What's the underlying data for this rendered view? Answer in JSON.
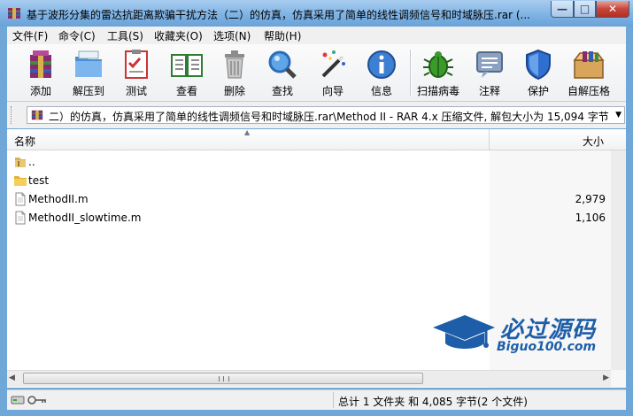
{
  "window": {
    "title": "基于波形分集的雷达抗距离欺骗干扰方法（二）的仿真，仿真采用了简单的线性调频信号和时域脉压.rar (...",
    "buttons": {
      "minimize": "—",
      "maximize": "□",
      "close": "✕"
    }
  },
  "menu": [
    "文件(F)",
    "命令(C)",
    "工具(S)",
    "收藏夹(O)",
    "选项(N)",
    "帮助(H)"
  ],
  "toolbar": [
    {
      "label": "添加",
      "icon": "add-archive-icon"
    },
    {
      "label": "解压到",
      "icon": "extract-to-icon"
    },
    {
      "label": "测试",
      "icon": "test-icon"
    },
    {
      "label": "查看",
      "icon": "view-book-icon"
    },
    {
      "label": "删除",
      "icon": "trash-icon"
    },
    {
      "label": "查找",
      "icon": "magnifier-icon"
    },
    {
      "label": "向导",
      "icon": "wizard-wand-icon"
    },
    {
      "label": "信息",
      "icon": "info-icon"
    },
    {
      "label": "扫描病毒",
      "icon": "virus-scan-icon"
    },
    {
      "label": "注释",
      "icon": "comment-icon"
    },
    {
      "label": "保护",
      "icon": "shield-icon"
    },
    {
      "label": "自解压格",
      "icon": "sfx-box-icon"
    }
  ],
  "address": {
    "path": "二）的仿真，仿真采用了简单的线性调频信号和时域脉压.rar\\Method II - RAR 4.x 压缩文件, 解包大小为 15,094 字节"
  },
  "columns": {
    "name": "名称",
    "size": "大小"
  },
  "files": [
    {
      "name": "..",
      "size": "",
      "type": "up"
    },
    {
      "name": "test",
      "size": "",
      "type": "folder"
    },
    {
      "name": "MethodII.m",
      "size": "2,979",
      "type": "file"
    },
    {
      "name": "MethodII_slowtime.m",
      "size": "1,106",
      "type": "file"
    }
  ],
  "watermark": {
    "title": "必过源码",
    "subtitle": "Biguo100.com"
  },
  "status": {
    "summary": "总计 1 文件夹 和 4,085 字节(2 个文件)"
  },
  "colors": {
    "titlebar": "#7fb3e4",
    "accent": "#1e5ea8",
    "close": "#c7473a"
  }
}
